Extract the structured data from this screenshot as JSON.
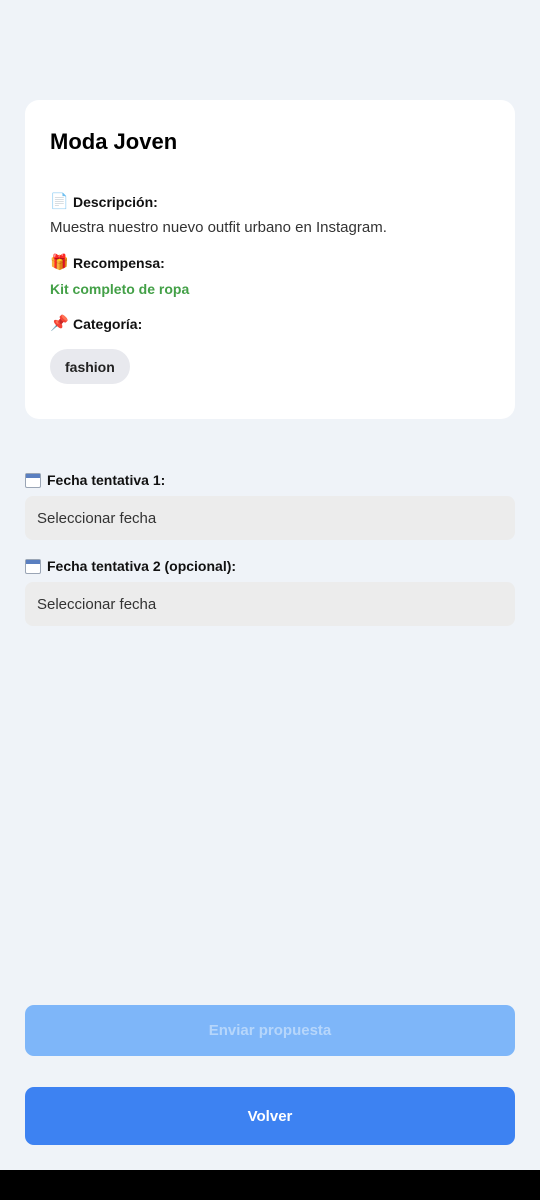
{
  "campaign": {
    "title": "Moda Joven",
    "description_label": "Descripción:",
    "description_icon": "document-icon",
    "description_text": "Muestra nuestro nuevo outfit urbano en Instagram.",
    "reward_label": "Recompensa:",
    "reward_icon": "gift-icon",
    "reward_text": "Kit completo de ropa",
    "category_label": "Categoría:",
    "category_icon": "pushpin-icon",
    "category_chip": "fashion"
  },
  "form": {
    "date1_label": "Fecha tentativa 1:",
    "date1_placeholder": "Seleccionar fecha",
    "date2_label": "Fecha tentativa 2 (opcional):",
    "date2_placeholder": "Seleccionar fecha",
    "calendar_icon": "calendar-icon"
  },
  "actions": {
    "submit_label": "Enviar propuesta",
    "back_label": "Volver"
  },
  "colors": {
    "background": "#eff3f8",
    "reward_green": "#43a047",
    "primary_blue": "#3d82f2",
    "disabled_blue": "#7eb6f9"
  }
}
